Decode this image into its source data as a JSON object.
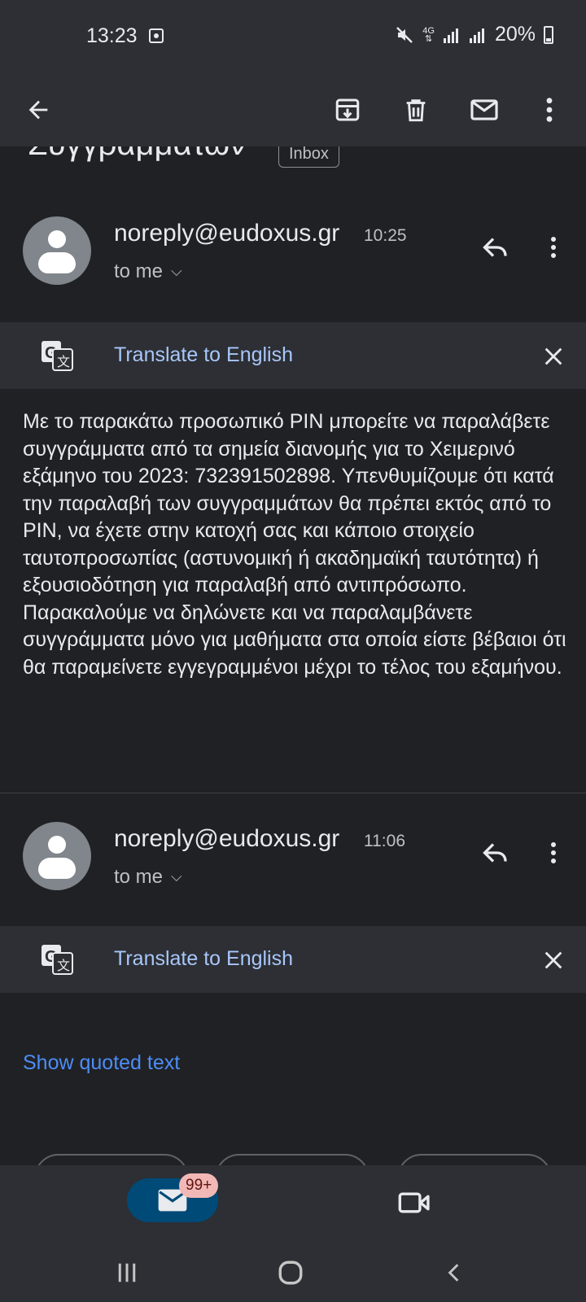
{
  "status_bar": {
    "time": "13:23",
    "network": "4G",
    "battery": "20%"
  },
  "toolbar": {
    "icons": [
      "back-arrow-icon",
      "archive-icon",
      "delete-icon",
      "mark-unread-icon",
      "more-vert-icon"
    ]
  },
  "email": {
    "subject_fragment": "Συγγραμματων",
    "label": "Inbox"
  },
  "messages": [
    {
      "sender": "noreply@eudoxus.gr",
      "time": "10:25",
      "recipient": "to me",
      "translate_label": "Translate to English",
      "body": "Με το παρακάτω προσωπικό PIN μπορείτε να παραλάβετε συγγράμματα από τα σημεία διανομής για το Χειμερινό εξάμηνο του 2023: 732391502898. Υπενθυμίζουμε ότι κατά την παραλαβή των συγγραμμάτων θα πρέπει εκτός από το PIN, να έχετε στην κατοχή σας και κάποιο στοιχείο ταυτοπροσωπίας (αστυνομική ή ακαδημαϊκή ταυτότητα) ή εξουσιοδότηση για παραλαβή από αντιπρόσωπο. Παρακαλούμε να δηλώνετε και να παραλαμβάνετε συγγράμματα μόνο για μαθήματα στα οποία είστε βέβαιοι ότι θα παραμείνετε εγγεγραμμένοι μέχρι το τέλος του εξαμήνου."
    },
    {
      "sender": "noreply@eudoxus.gr",
      "time": "11:06",
      "recipient": "to me",
      "translate_label": "Translate to English",
      "show_quoted": "Show quoted text"
    }
  ],
  "bottom_nav": {
    "mail_badge": "99+"
  },
  "colors": {
    "background": "#202124",
    "surface": "#2d2f34",
    "link": "#4c8df6",
    "translate_link": "#a8c7fa",
    "mail_pill": "#004a77",
    "badge": "#f2b8b5"
  }
}
